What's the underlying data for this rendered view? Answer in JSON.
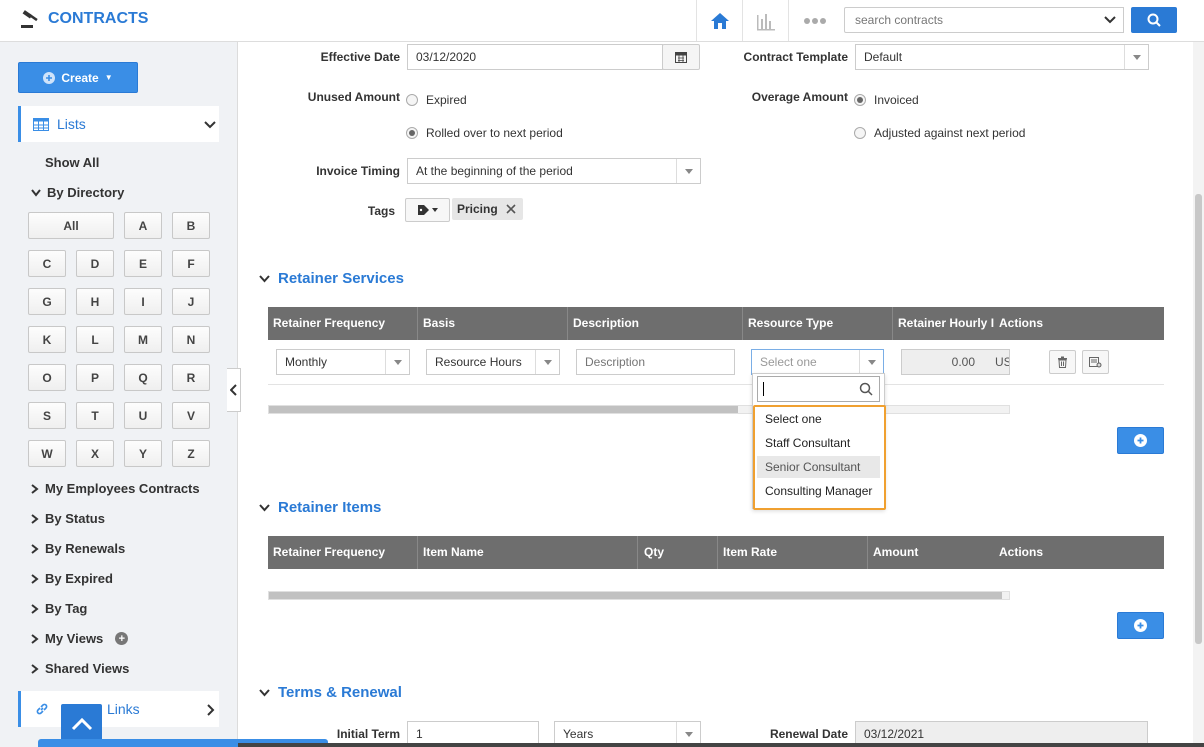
{
  "app": {
    "title": "CONTRACTS"
  },
  "search": {
    "placeholder": "search contracts"
  },
  "sidebar": {
    "create_label": "Create",
    "lists_label": "Lists",
    "show_all": "Show All",
    "by_directory": "By Directory",
    "letters": [
      "All",
      "A",
      "B",
      "C",
      "D",
      "E",
      "F",
      "G",
      "H",
      "I",
      "J",
      "K",
      "L",
      "M",
      "N",
      "O",
      "P",
      "Q",
      "R",
      "S",
      "T",
      "U",
      "V",
      "W",
      "X",
      "Y",
      "Z"
    ],
    "tree": [
      "My Employees Contracts",
      "By Status",
      "By Renewals",
      "By Expired",
      "By Tag",
      "My Views",
      "Shared Views"
    ],
    "quick_links": "Links"
  },
  "form": {
    "effective_date_label": "Effective Date",
    "effective_date_value": "03/12/2020",
    "contract_template_label": "Contract Template",
    "contract_template_value": "Default",
    "unused_amount_label": "Unused Amount",
    "unused_options": [
      "Expired",
      "Rolled over to next period"
    ],
    "unused_selected": 1,
    "overage_amount_label": "Overage Amount",
    "overage_options": [
      "Invoiced",
      "Adjusted against next period"
    ],
    "overage_selected": 0,
    "invoice_timing_label": "Invoice Timing",
    "invoice_timing_value": "At the beginning of the period",
    "tags_label": "Tags",
    "tag_pricing": "Pricing"
  },
  "retainer_services": {
    "title": "Retainer Services",
    "columns": [
      "Retainer Frequency",
      "Basis",
      "Description",
      "Resource Type",
      "Retainer Hourly I",
      "Actions"
    ],
    "row": {
      "frequency": "Monthly",
      "basis": "Resource Hours",
      "description_placeholder": "Description",
      "resource_type_placeholder": "Select one",
      "rate": "0.00",
      "currency": "US"
    },
    "dropdown_options": [
      "Select one",
      "Staff Consultant",
      "Senior Consultant",
      "Consulting Manager"
    ],
    "dropdown_hover": 2
  },
  "retainer_items": {
    "title": "Retainer Items",
    "columns": [
      "Retainer Frequency",
      "Item Name",
      "Qty",
      "Item Rate",
      "Amount",
      "Actions"
    ]
  },
  "terms": {
    "title": "Terms & Renewal",
    "initial_term_label": "Initial Term",
    "initial_term_value": "1",
    "term_unit": "Years",
    "renewal_date_label": "Renewal Date",
    "renewal_date_value": "03/12/2021"
  },
  "colors": {
    "accent": "#2a7ad5",
    "header": "#6e6e6e",
    "highlight": "#f0a030"
  }
}
